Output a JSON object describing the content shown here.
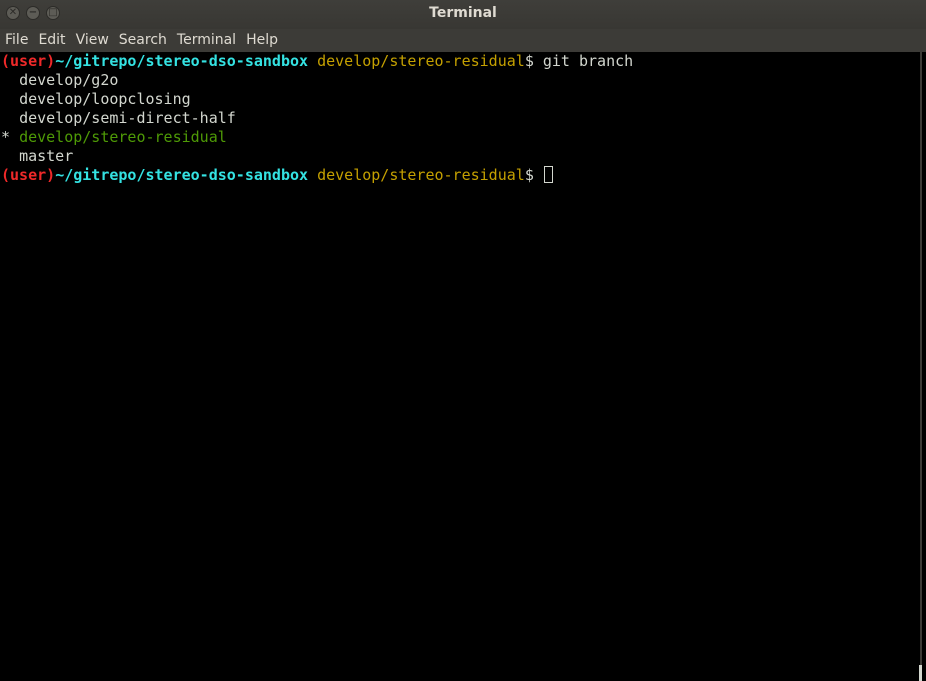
{
  "window": {
    "title": "Terminal"
  },
  "menu": {
    "items": [
      "File",
      "Edit",
      "View",
      "Search",
      "Terminal",
      "Help"
    ]
  },
  "prompt": {
    "user": "(user)",
    "path": "~/gitrepo/stereo-dso-sandbox",
    "branch": "develop/stereo-residual",
    "symbol": "$"
  },
  "command": "git branch",
  "branches": [
    {
      "marker": " ",
      "name": "develop/g2o",
      "current": false
    },
    {
      "marker": " ",
      "name": "develop/loopclosing",
      "current": false
    },
    {
      "marker": " ",
      "name": "develop/semi-direct-half",
      "current": false
    },
    {
      "marker": "*",
      "name": "develop/stereo-residual",
      "current": true
    },
    {
      "marker": " ",
      "name": "master",
      "current": false
    }
  ],
  "colors": {
    "user": "#ef2929",
    "path": "#34e2e2",
    "branch": "#c4a000",
    "current_branch": "#4e9a06",
    "text": "#d3d7cf",
    "background": "#000000"
  }
}
